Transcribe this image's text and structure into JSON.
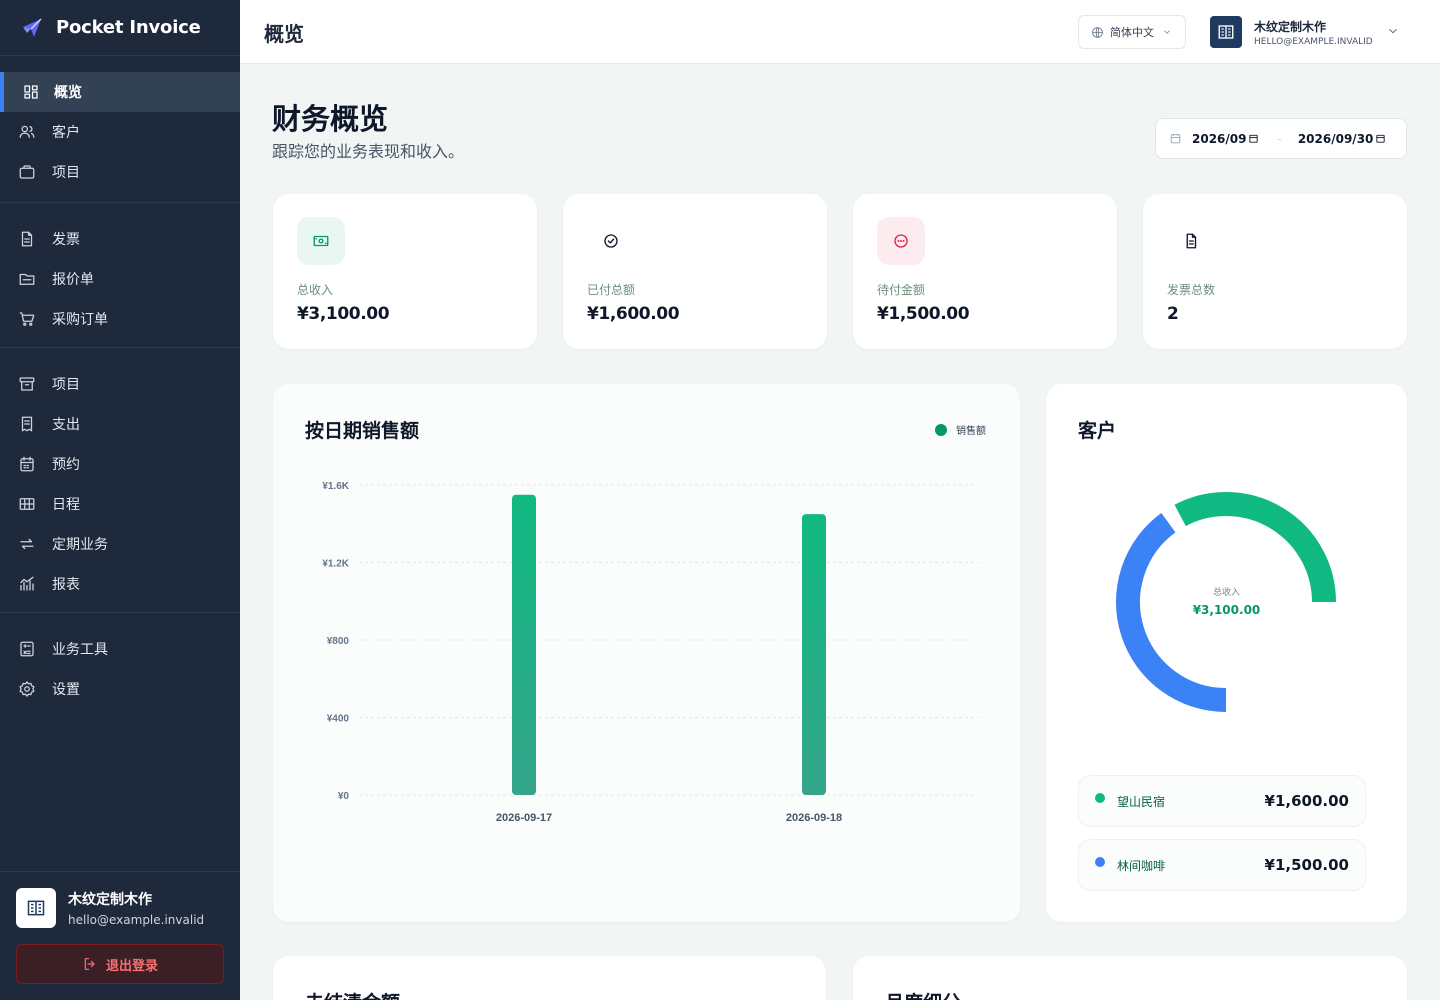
{
  "app": {
    "name": "Pocket Invoice"
  },
  "sidebar": {
    "items": [
      {
        "label": "概览",
        "icon": "dashboard-icon",
        "active": true
      },
      {
        "label": "客户",
        "icon": "users-icon"
      },
      {
        "label": "项目",
        "icon": "briefcase-icon"
      },
      {
        "label": "发票",
        "icon": "document-icon"
      },
      {
        "label": "报价单",
        "icon": "folder-icon"
      },
      {
        "label": "采购订单",
        "icon": "cart-icon"
      },
      {
        "label": "项目",
        "icon": "archive-icon"
      },
      {
        "label": "支出",
        "icon": "receipt-icon"
      },
      {
        "label": "预约",
        "icon": "calendar-icon"
      },
      {
        "label": "日程",
        "icon": "table-icon"
      },
      {
        "label": "定期业务",
        "icon": "repeat-icon"
      },
      {
        "label": "报表",
        "icon": "chart-icon"
      },
      {
        "label": "业务工具",
        "icon": "calculator-icon"
      },
      {
        "label": "设置",
        "icon": "gear-icon"
      }
    ],
    "user": {
      "name": "木纹定制木作",
      "email": "hello@example.invalid"
    },
    "logout_label": "退出登录"
  },
  "header": {
    "title": "概览",
    "language": "简体中文",
    "user_name": "木纹定制木作",
    "user_email": "HELLO@EXAMPLE.INVALID"
  },
  "page": {
    "title": "财务概览",
    "subtitle": "跟踪您的业务表现和收入。",
    "date_from": "2026/09",
    "date_to": "2026/09/30"
  },
  "stats": [
    {
      "label": "总收入",
      "value": "¥3,100.00",
      "icon": "money-icon",
      "color": "#059669",
      "bg": "#e8f8f0"
    },
    {
      "label": "已付总额",
      "value": "¥1,600.00",
      "icon": "check-circle-icon",
      "color": "#0f172a",
      "bg": "#ffffff"
    },
    {
      "label": "待付金额",
      "value": "¥1,500.00",
      "icon": "pending-icon",
      "color": "#e11d48",
      "bg": "#fdecef"
    },
    {
      "label": "发票总数",
      "value": "2",
      "icon": "file-icon",
      "color": "#0f172a",
      "bg": "#ffffff"
    }
  ],
  "sales_chart": {
    "title": "按日期销售额",
    "legend": "销售额"
  },
  "chart_data": {
    "type": "bar",
    "title": "按日期销售额",
    "categories": [
      "2026-09-17",
      "2026-09-18"
    ],
    "series": [
      {
        "name": "销售额",
        "values": [
          1550,
          1450
        ],
        "color": "#10b981"
      }
    ],
    "yticks": [
      "¥0",
      "¥400",
      "¥800",
      "¥1.2K",
      "¥1.6K"
    ],
    "ytick_values": [
      0,
      400,
      800,
      1200,
      1600
    ],
    "ylim": [
      0,
      1600
    ],
    "grid": true,
    "legend_position": "top-right"
  },
  "customers": {
    "title": "客户",
    "total_label": "总收入",
    "total_value": "¥3,100.00",
    "items": [
      {
        "name": "望山民宿",
        "amount": "¥1,600.00",
        "value": 1600,
        "color": "#10b981"
      },
      {
        "name": "林间咖啡",
        "amount": "¥1,500.00",
        "value": 1500,
        "color": "#3b82f6"
      }
    ]
  },
  "bottom_cards": [
    {
      "title": "未结清金额"
    },
    {
      "title": "月度细分"
    }
  ]
}
